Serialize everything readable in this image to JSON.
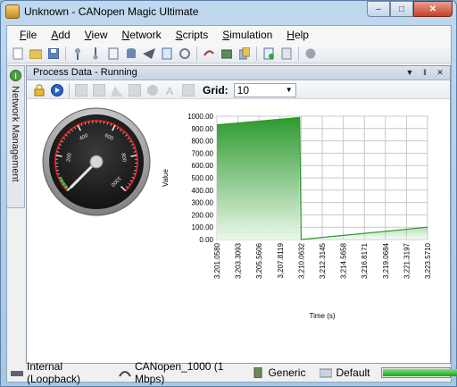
{
  "window": {
    "title": "Unknown - CANopen Magic Ultimate",
    "controls": {
      "minimize": "–",
      "maximize": "□",
      "close": "✕"
    }
  },
  "menu": {
    "items": [
      {
        "label": "File"
      },
      {
        "label": "Add"
      },
      {
        "label": "View"
      },
      {
        "label": "Network"
      },
      {
        "label": "Scripts"
      },
      {
        "label": "Simulation"
      },
      {
        "label": "Help"
      }
    ]
  },
  "toolbar": {
    "icons": [
      "new-icon",
      "open-icon",
      "save-icon",
      "connect-icon",
      "disconnect-icon",
      "document-icon",
      "database-icon",
      "send-icon",
      "script-icon",
      "refresh-icon",
      "undo-icon",
      "device-icon",
      "copy-icon",
      "add-icon",
      "paste-icon",
      "stop-icon"
    ]
  },
  "sidebar": {
    "tab_label": "Network Management"
  },
  "panel": {
    "title": "Process Data - Running",
    "header_buttons": {
      "dropdown": "▼",
      "pin": "‖",
      "close": "✕"
    },
    "grid_label": "Grid:",
    "grid_value": "10"
  },
  "gauge": {
    "tick_labels": [
      "0",
      "200",
      "400",
      "600",
      "800",
      "1000"
    ],
    "min": 0,
    "max": 1000,
    "value": 0,
    "colors": {
      "face": "#1f1f1f",
      "scale": "#d21a1a",
      "zone_low": "#2fa82f"
    }
  },
  "chart_data": {
    "type": "area",
    "xlabel": "Time (s)",
    "ylabel": "Value",
    "ylim": [
      0,
      1000
    ],
    "y_ticks": [
      "0.00",
      "100.00",
      "200.00",
      "300.00",
      "400.00",
      "500.00",
      "600.00",
      "700.00",
      "800.00",
      "900.00",
      "1000.00"
    ],
    "x_ticks": [
      "3,201.0580",
      "3,203.3093",
      "3,205.5606",
      "3,207.8119",
      "3,210.0632",
      "3,212.3145",
      "3,214.5658",
      "3,216.8171",
      "3,219.0684",
      "3,221.3197",
      "3,223.5710"
    ],
    "series": [
      {
        "color": "#2e9a2e",
        "points": [
          {
            "x": 3201.058,
            "y": 930
          },
          {
            "x": 3209.9,
            "y": 990
          },
          {
            "x": 3210.06,
            "y": 0
          },
          {
            "x": 3223.571,
            "y": 100
          }
        ]
      }
    ],
    "grid": true
  },
  "status": {
    "items": [
      {
        "icon": "connection-icon",
        "label": "Internal (Loopback)"
      },
      {
        "icon": "can-icon",
        "label": "CANopen_1000 (1 Mbps)"
      },
      {
        "icon": "profile-icon",
        "label": "Generic"
      },
      {
        "icon": "folder-icon",
        "label": "Default"
      }
    ],
    "progress": 1.0
  }
}
